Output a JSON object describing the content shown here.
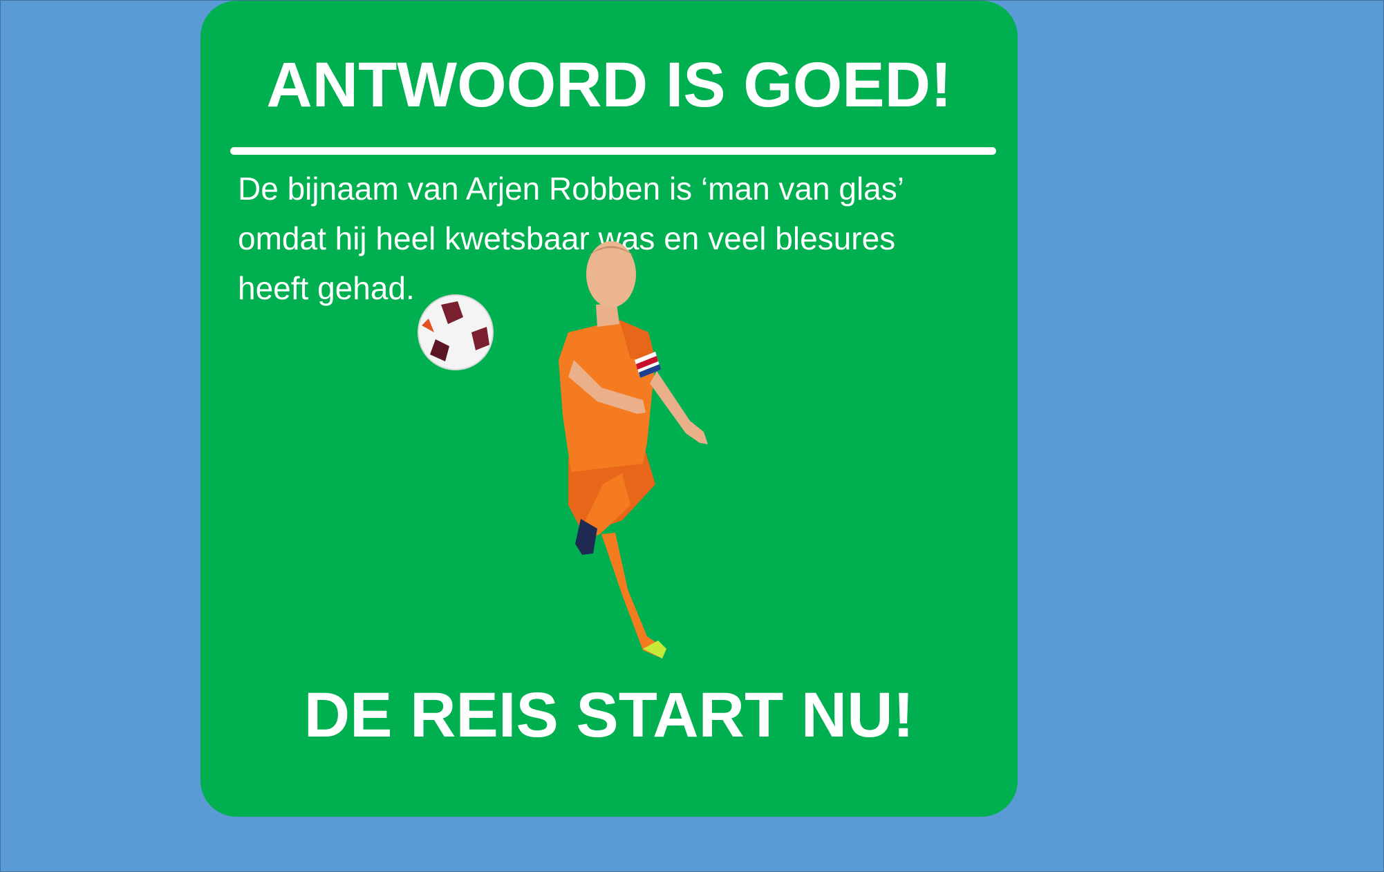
{
  "slide": {
    "title": "ANTWOORD IS GOED!",
    "body": "De bijnaam van Arjen Robben is ‘man van glas’ omdat hij heel kwetsbaar was en veel blesures heeft gehad.",
    "cta": "DE REIS START NU!",
    "photo_icon": "football-player-kicking-ball-illustration",
    "colors": {
      "background": "#5b9bd5",
      "card": "#00b050",
      "text": "#ffffff",
      "jersey": "#f47b20"
    }
  }
}
